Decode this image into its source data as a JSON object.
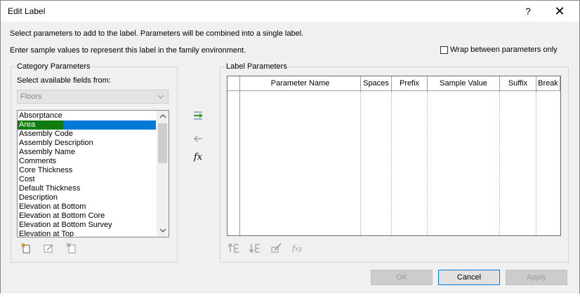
{
  "window": {
    "title": "Edit Label",
    "help_label": "?",
    "close_label": "✕"
  },
  "info": {
    "line1": "Select parameters to add to the label.  Parameters will be combined into a single label.",
    "line2": "Enter sample values to represent this label in the family environment."
  },
  "wrap_option": {
    "label": "Wrap between parameters only",
    "checked": false
  },
  "category": {
    "group_label": "Category Parameters",
    "fields_label": "Select available fields from:",
    "dropdown_value": "Floors",
    "items": [
      "Absorptance",
      "Area",
      "Assembly Code",
      "Assembly Description",
      "Assembly Name",
      "Comments",
      "Core Thickness",
      "Cost",
      "Default Thickness",
      "Description",
      "Elevation at Bottom",
      "Elevation at Bottom Core",
      "Elevation at Bottom Survey",
      "Elevation at Top"
    ],
    "selected_item": "Area",
    "tools": [
      "new-parameter-icon",
      "edit-parameter-icon",
      "delete-parameter-icon"
    ]
  },
  "transfer": {
    "add_icon": "add-to-label-icon",
    "remove_icon": "remove-from-label-icon",
    "formula_label": "fx"
  },
  "label_params": {
    "group_label": "Label Parameters",
    "columns": [
      "Parameter Name",
      "Spaces",
      "Prefix",
      "Sample Value",
      "Suffix",
      "Break"
    ],
    "rows": [],
    "tools": [
      "move-up-icon",
      "move-down-icon",
      "edit-parameter-icon",
      "edit-formula-icon"
    ]
  },
  "buttons": {
    "ok": "OK",
    "cancel": "Cancel",
    "apply": "Apply"
  },
  "colors": {
    "selection_green": "#107c10",
    "selection_blue": "#0078d7",
    "accent_green": "#3a9a3a"
  }
}
